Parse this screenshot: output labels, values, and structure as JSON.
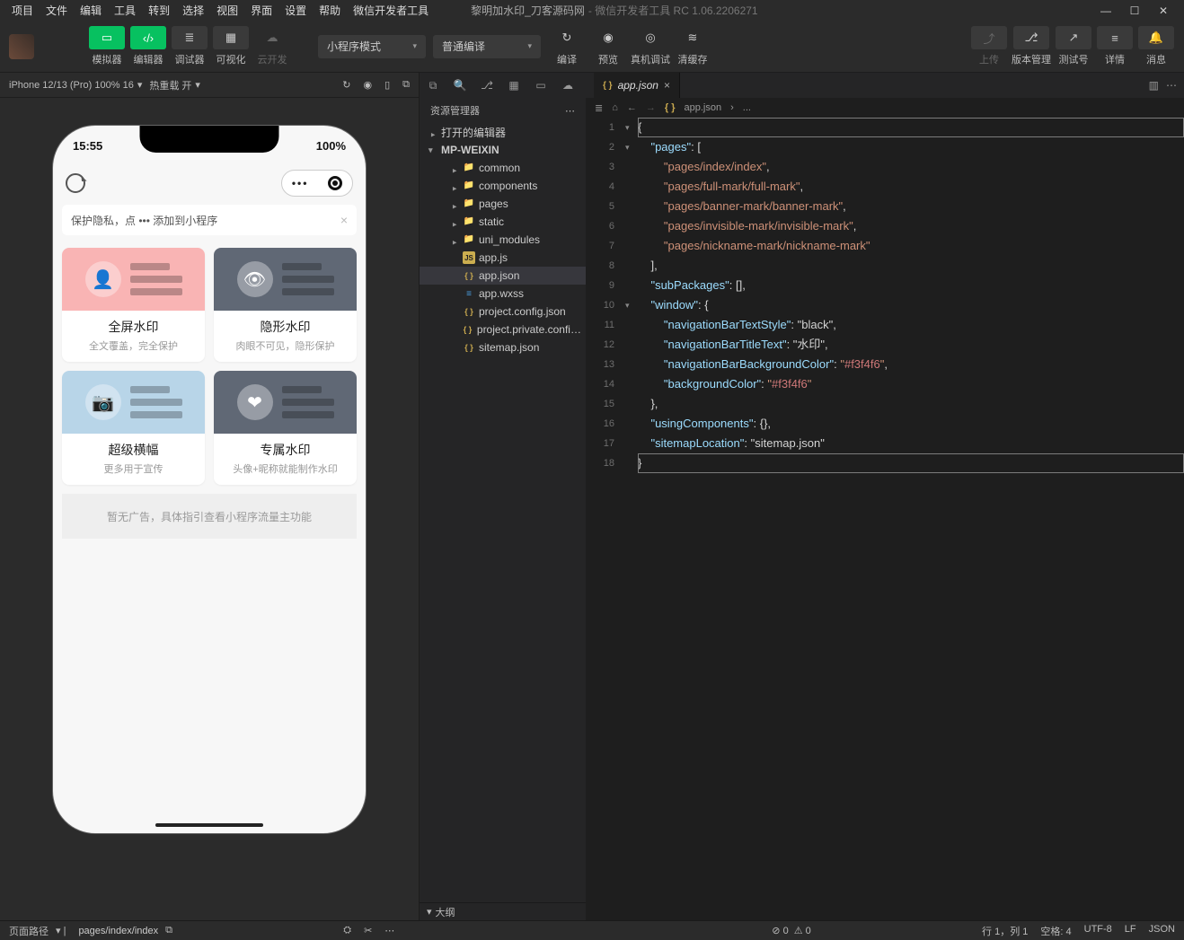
{
  "menu": {
    "items": [
      "项目",
      "文件",
      "编辑",
      "工具",
      "转到",
      "选择",
      "视图",
      "界面",
      "设置",
      "帮助",
      "微信开发者工具"
    ],
    "title": "黎明加水印_刀客源码网",
    "title2": " - 微信开发者工具 RC 1.06.2206271"
  },
  "toolbar": {
    "simulator": "模拟器",
    "editor": "编辑器",
    "debugger": "调试器",
    "visualize": "可视化",
    "cloud": "云开发",
    "modeSel": "小程序模式",
    "compileSel": "普通编译",
    "compile": "编译",
    "preview": "预览",
    "remote": "真机调试",
    "clear": "清缓存",
    "upload": "上传",
    "version": "版本管理",
    "testId": "测试号",
    "detail": "详情",
    "message": "消息"
  },
  "sim": {
    "device": "iPhone 12/13 (Pro) 100% 16",
    "reload": "热重载 开"
  },
  "phone": {
    "time": "15:55",
    "battery": "100%",
    "tip": "保护隐私，点 ••• 添加到小程序",
    "cards": [
      {
        "title": "全屏水印",
        "sub": "全文覆盖，完全保护",
        "bg": "pink"
      },
      {
        "title": "隐形水印",
        "sub": "肉眼不可见，隐形保护",
        "bg": "gray"
      },
      {
        "title": "超级横幅",
        "sub": "更多用于宣传",
        "bg": "blue"
      },
      {
        "title": "专属水印",
        "sub": "头像+昵称就能制作水印",
        "bg": "gray"
      }
    ],
    "ad": "暂无广告，具体指引查看小程序流量主功能"
  },
  "explorer": {
    "title": "资源管理器",
    "open": "打开的编辑器",
    "proj": "MP-WEIXIN",
    "tree": [
      {
        "t": "folder",
        "n": "common",
        "l": 2
      },
      {
        "t": "folder",
        "n": "components",
        "l": 2
      },
      {
        "t": "folder",
        "n": "pages",
        "l": 2
      },
      {
        "t": "folder",
        "n": "static",
        "l": 2
      },
      {
        "t": "folder",
        "n": "uni_modules",
        "l": 2
      },
      {
        "t": "js",
        "n": "app.js",
        "l": 2
      },
      {
        "t": "json",
        "n": "app.json",
        "l": 2,
        "sel": true
      },
      {
        "t": "wxss",
        "n": "app.wxss",
        "l": 2
      },
      {
        "t": "json",
        "n": "project.config.json",
        "l": 2
      },
      {
        "t": "json",
        "n": "project.private.config.js...",
        "l": 2
      },
      {
        "t": "json",
        "n": "sitemap.json",
        "l": 2
      }
    ],
    "outline": "大纲"
  },
  "tab": {
    "name": "app.json"
  },
  "breadcrumb": {
    "file": "app.json",
    "more": "..."
  },
  "code": {
    "lines": [
      "{",
      "    \"pages\": [",
      "        \"pages/index/index\",",
      "        \"pages/full-mark/full-mark\",",
      "        \"pages/banner-mark/banner-mark\",",
      "        \"pages/invisible-mark/invisible-mark\",",
      "        \"pages/nickname-mark/nickname-mark\"",
      "    ],",
      "    \"subPackages\": [],",
      "    \"window\": {",
      "        \"navigationBarTextStyle\": \"black\",",
      "        \"navigationBarTitleText\": \"水印\",",
      "        \"navigationBarBackgroundColor\": \"#f3f4f6\",",
      "        \"backgroundColor\": \"#f3f4f6\"",
      "    },",
      "    \"usingComponents\": {},",
      "    \"sitemapLocation\": \"sitemap.json\"",
      "}"
    ]
  },
  "status": {
    "path": "页面路径",
    "page": "pages/index/index",
    "err": "0",
    "warn": "0",
    "pos": "行 1，列 1",
    "space": "空格: 4",
    "enc": "UTF-8",
    "eol": "LF",
    "lang": "JSON"
  }
}
